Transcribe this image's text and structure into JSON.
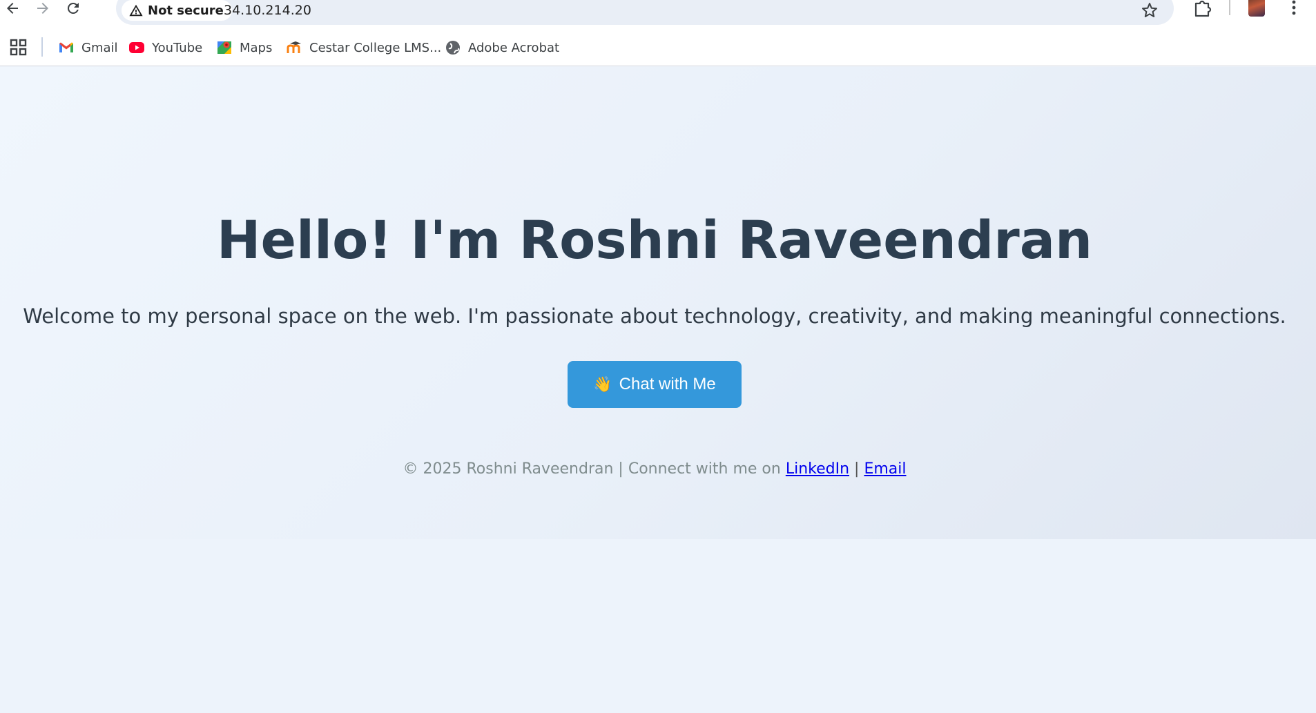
{
  "browser": {
    "security_label": "Not secure",
    "url": "34.10.214.20"
  },
  "bookmarks": [
    {
      "label": "Gmail",
      "icon": "gmail-icon"
    },
    {
      "label": "YouTube",
      "icon": "youtube-icon"
    },
    {
      "label": "Maps",
      "icon": "maps-icon"
    },
    {
      "label": "Cestar College LMS...",
      "icon": "moodle-icon"
    },
    {
      "label": "Adobe Acrobat",
      "icon": "globe-icon"
    }
  ],
  "hero": {
    "title": "Hello! I'm Roshni Raveendran",
    "subtitle": "Welcome to my personal space on the web. I'm passionate about technology, creativity, and making meaningful connections.",
    "button_emoji": "👋",
    "button_label": "Chat with Me"
  },
  "footer": {
    "text": "© 2025 Roshni Raveendran | Connect with me on",
    "linkedin_label": "LinkedIn",
    "separator": "|",
    "email_label": "Email"
  },
  "colors": {
    "accent": "#3498db",
    "heading": "#2c3e50",
    "link": "#0000ee"
  }
}
